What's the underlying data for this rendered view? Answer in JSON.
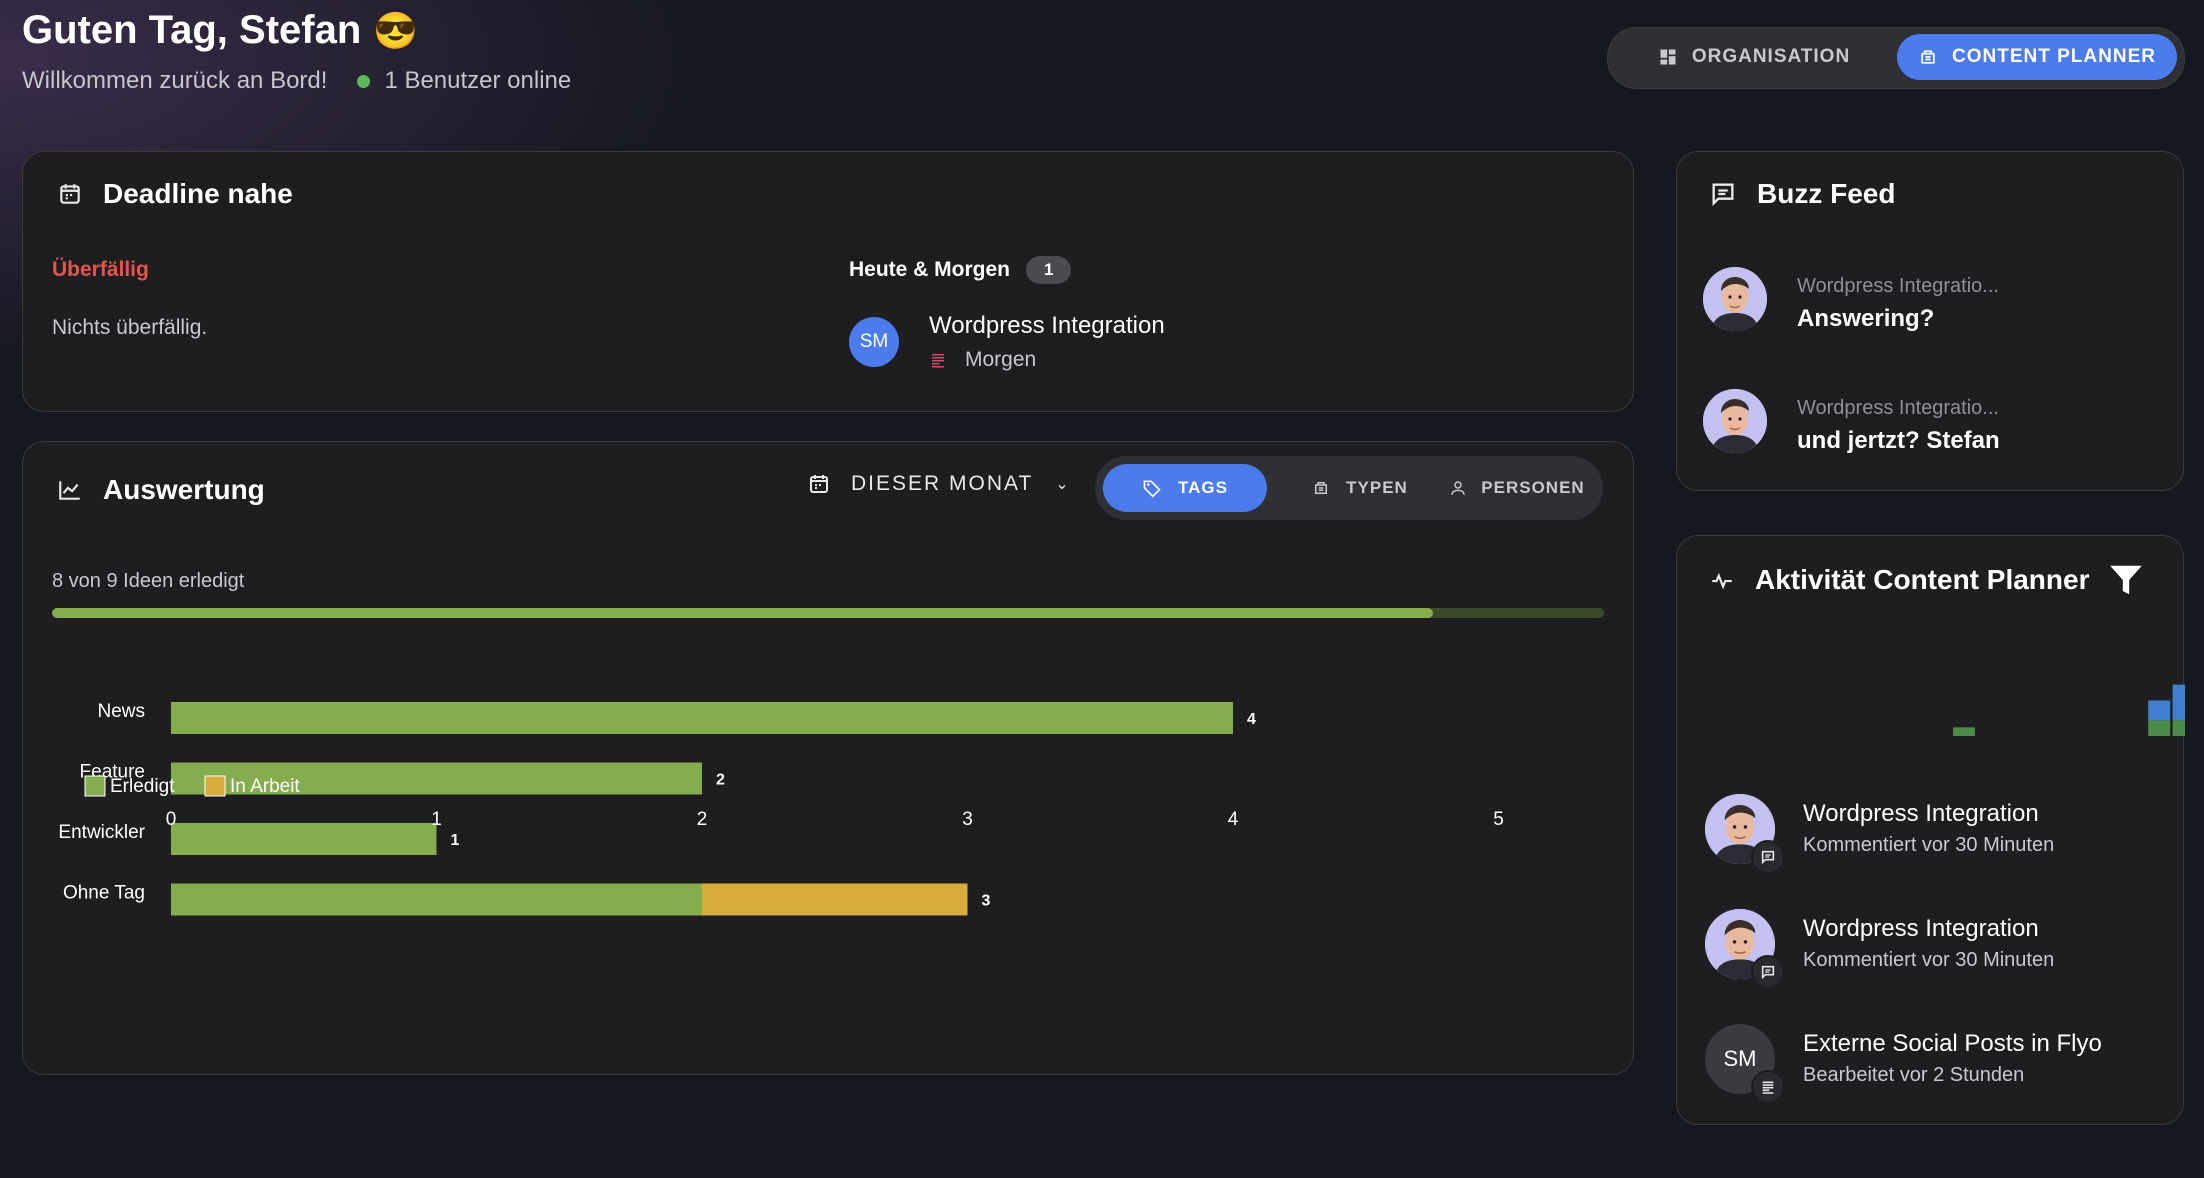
{
  "header": {
    "greeting": "Guten Tag, Stefan",
    "emoji": "😎",
    "welcome": "Willkommen zurück an Bord!",
    "online": "1 Benutzer online",
    "tabs": [
      {
        "label": "ORGANISATION",
        "active": false
      },
      {
        "label": "CONTENT PLANNER",
        "active": true
      }
    ]
  },
  "deadline": {
    "title": "Deadline nahe",
    "overdue_label": "Überfällig",
    "overdue_empty": "Nichts überfällig.",
    "soon_label": "Heute & Morgen",
    "soon_count": "1",
    "item": {
      "initials": "SM",
      "title": "Wordpress Integration",
      "due": "Morgen"
    }
  },
  "evaluation": {
    "title": "Auswertung",
    "period": "DIESER MONAT",
    "tabs": [
      {
        "label": "TAGS",
        "active": true
      },
      {
        "label": "TYPEN",
        "active": false
      },
      {
        "label": "PERSONEN",
        "active": false
      }
    ],
    "progress_text": "8 von 9 Ideen erledigt",
    "progress": 0.89
  },
  "chart_data": {
    "type": "bar",
    "orientation": "horizontal",
    "stacked": true,
    "categories": [
      "News",
      "Feature",
      "Entwickler",
      "Ohne Tag"
    ],
    "series": [
      {
        "name": "Erledigt",
        "values": [
          4,
          2,
          1,
          2
        ],
        "color": "#85ad4e"
      },
      {
        "name": "In Arbeit",
        "values": [
          0,
          0,
          0,
          1
        ],
        "color": "#d7ab3c"
      }
    ],
    "totals": [
      "4",
      "2",
      "1",
      "3"
    ],
    "xticks": [
      "0",
      "1",
      "2",
      "3",
      "4",
      "5"
    ],
    "xlim": [
      0,
      5
    ],
    "legend": "bottom-left",
    "grid": false
  },
  "buzz": {
    "title": "Buzz Feed",
    "items": [
      {
        "context": "Wordpress Integratio...",
        "text": "Answering?"
      },
      {
        "context": "Wordpress Integratio...",
        "text": "und jertzt? Stefan"
      }
    ]
  },
  "activity": {
    "title": "Aktivität Content Planner",
    "mini_chart": {
      "type": "bar",
      "stacked": true,
      "series": [
        {
          "color": "#4e8a4a",
          "values": [
            0,
            0,
            0,
            0,
            0,
            1,
            0,
            0,
            0,
            0,
            0,
            0,
            0,
            4,
            4,
            4
          ]
        },
        {
          "color": "#3f7fcf",
          "values": [
            0,
            0,
            0,
            0,
            0,
            0,
            0,
            0,
            0,
            0,
            0,
            0,
            0,
            5,
            9,
            15
          ]
        }
      ]
    },
    "items": [
      {
        "title": "Wordpress Integration",
        "sub": "Kommentiert vor 30 Minuten",
        "avatar": "photo",
        "badge": "comment"
      },
      {
        "title": "Wordpress Integration",
        "sub": "Kommentiert vor 30 Minuten",
        "avatar": "photo",
        "badge": "comment"
      },
      {
        "title": "Externe Social Posts in Flyo",
        "sub": "Bearbeitet vor 2 Stunden",
        "avatar": "SM",
        "badge": "notes"
      }
    ]
  },
  "colors": {
    "accent": "#4b7bec",
    "overdue": "#e5534b",
    "done": "#85ad4e",
    "in_progress": "#d7ab3c",
    "online": "#5cb85c"
  }
}
